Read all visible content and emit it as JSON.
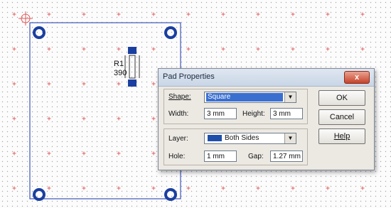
{
  "component": {
    "ref": "R1",
    "value": "390"
  },
  "dialog": {
    "title": "Pad Properties",
    "close_label": "x",
    "shape_label": "Shape:",
    "shape_value": "Square",
    "width_label": "Width:",
    "width_value": "3 mm",
    "height_label": "Height:",
    "height_value": "3 mm",
    "layer_label": "Layer:",
    "layer_value": "Both Sides",
    "layer_color": "#1f4fa8",
    "hole_label": "Hole:",
    "hole_value": "1 mm",
    "gap_label": "Gap:",
    "gap_value": "1.27 mm",
    "ok_label": "OK",
    "cancel_label": "Cancel",
    "help_label": "Help"
  },
  "colors": {
    "board_outline": "#3b57b5",
    "grid_dot": "#a9a9a9",
    "grid_cross": "#e06060",
    "pad": "#1a3fa0"
  }
}
